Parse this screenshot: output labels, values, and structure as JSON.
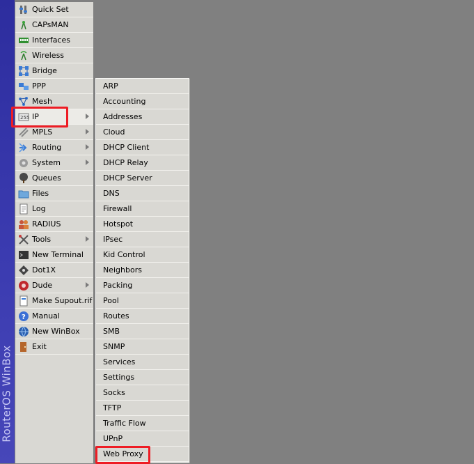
{
  "brand": "RouterOS WinBox",
  "main_menu": [
    {
      "label": "Quick Set",
      "icon": "quick-set-icon",
      "has_submenu": false
    },
    {
      "label": "CAPsMAN",
      "icon": "capsman-antenna-icon",
      "has_submenu": false
    },
    {
      "label": "Interfaces",
      "icon": "interfaces-card-icon",
      "has_submenu": false
    },
    {
      "label": "Wireless",
      "icon": "wireless-antenna-icon",
      "has_submenu": false
    },
    {
      "label": "Bridge",
      "icon": "bridge-icon",
      "has_submenu": false
    },
    {
      "label": "PPP",
      "icon": "ppp-icon",
      "has_submenu": false
    },
    {
      "label": "Mesh",
      "icon": "mesh-icon",
      "has_submenu": false
    },
    {
      "label": "IP",
      "icon": "ip-icon",
      "has_submenu": true,
      "active": true
    },
    {
      "label": "MPLS",
      "icon": "mpls-icon",
      "has_submenu": true
    },
    {
      "label": "Routing",
      "icon": "routing-icon",
      "has_submenu": true
    },
    {
      "label": "System",
      "icon": "system-gear-icon",
      "has_submenu": true
    },
    {
      "label": "Queues",
      "icon": "queues-tree-icon",
      "has_submenu": false
    },
    {
      "label": "Files",
      "icon": "folder-icon",
      "has_submenu": false
    },
    {
      "label": "Log",
      "icon": "log-page-icon",
      "has_submenu": false
    },
    {
      "label": "RADIUS",
      "icon": "radius-users-icon",
      "has_submenu": false
    },
    {
      "label": "Tools",
      "icon": "tools-icon",
      "has_submenu": true
    },
    {
      "label": "New Terminal",
      "icon": "terminal-icon",
      "has_submenu": false
    },
    {
      "label": "Dot1X",
      "icon": "dot1x-icon",
      "has_submenu": false
    },
    {
      "label": "Dude",
      "icon": "dude-icon",
      "has_submenu": true
    },
    {
      "label": "Make Supout.rif",
      "icon": "supout-file-icon",
      "has_submenu": false
    },
    {
      "label": "Manual",
      "icon": "help-icon",
      "has_submenu": false
    },
    {
      "label": "New WinBox",
      "icon": "winbox-globe-icon",
      "has_submenu": false
    },
    {
      "label": "Exit",
      "icon": "exit-door-icon",
      "has_submenu": false
    }
  ],
  "ip_submenu": [
    "ARP",
    "Accounting",
    "Addresses",
    "Cloud",
    "DHCP Client",
    "DHCP Relay",
    "DHCP Server",
    "DNS",
    "Firewall",
    "Hotspot",
    "IPsec",
    "Kid Control",
    "Neighbors",
    "Packing",
    "Pool",
    "Routes",
    "SMB",
    "SNMP",
    "Services",
    "Settings",
    "Socks",
    "TFTP",
    "Traffic Flow",
    "UPnP",
    "Web Proxy"
  ],
  "colors": {
    "menu_bg": "#d9d8d3",
    "desktop_bg": "#808080",
    "sidebar_band": "#3b3bb0",
    "highlight": "#ee1c24"
  }
}
